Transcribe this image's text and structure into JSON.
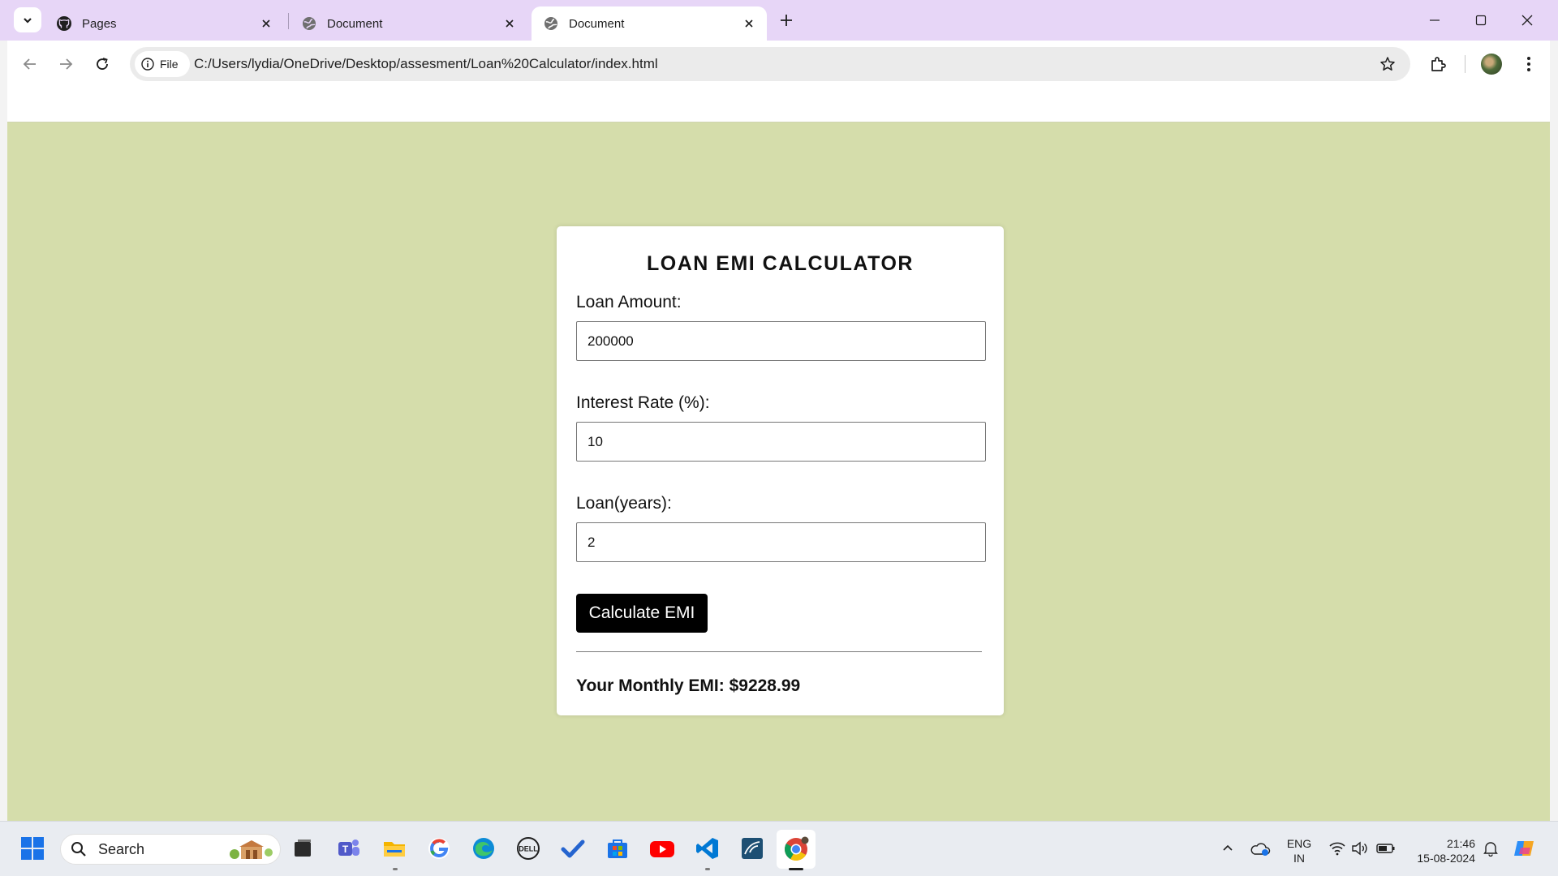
{
  "browser": {
    "tabs": [
      {
        "title": "Pages",
        "favicon": "github-icon",
        "active": false
      },
      {
        "title": "Document",
        "favicon": "globe-icon",
        "active": false
      },
      {
        "title": "Document",
        "favicon": "globe-icon",
        "active": true
      }
    ],
    "site_chip_label": "File",
    "url": "C:/Users/lydia/OneDrive/Desktop/assesment/Loan%20Calculator/index.html"
  },
  "page": {
    "background_color": "#d5ddab",
    "title": "LOAN EMI CALCULATOR",
    "fields": [
      {
        "label": "Loan Amount:",
        "value": "200000"
      },
      {
        "label": "Interest Rate (%):",
        "value": "10"
      },
      {
        "label": "Loan(years):",
        "value": "2"
      }
    ],
    "button_label": "Calculate EMI",
    "result_text": "Your Monthly EMI: $9228.99"
  },
  "taskbar": {
    "search_placeholder": "Search",
    "apps": [
      "windows-start-icon",
      "task-view-icon",
      "teams-icon",
      "file-explorer-icon",
      "google-icon",
      "edge-icon",
      "dell-icon",
      "todo-icon",
      "store-icon",
      "youtube-icon",
      "vscode-icon",
      "mysql-workbench-icon",
      "chrome-icon"
    ],
    "language_line1": "ENG",
    "language_line2": "IN",
    "time": "21:46",
    "date": "15-08-2024"
  }
}
